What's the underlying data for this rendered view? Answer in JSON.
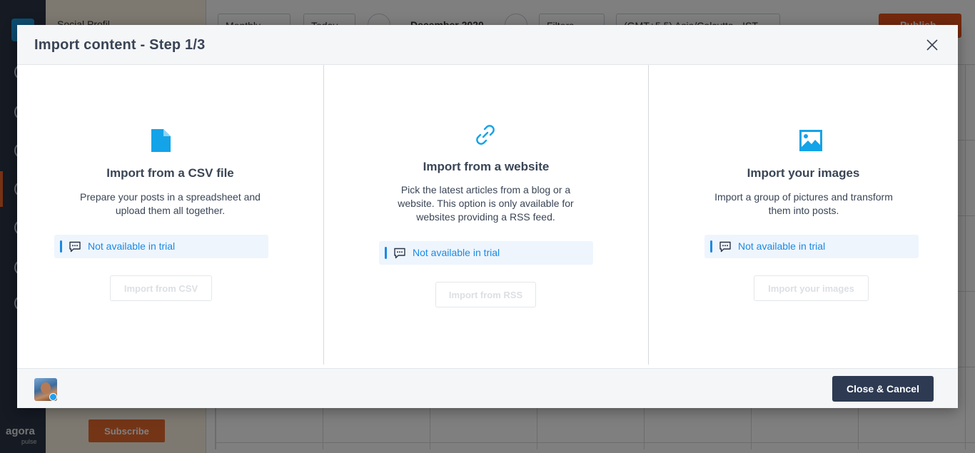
{
  "background": {
    "panel_title": "Social Profil...",
    "view_select": "Monthly",
    "today_button": "Today",
    "month_label": "December 2020",
    "filters_button": "Filters",
    "timezone_select": "(GMT+5.5) Asia/Calcutta - IST",
    "publish_button": "Publish",
    "subscribe_button": "Subscribe",
    "brand": "agora",
    "brand_sub": "pulse"
  },
  "modal": {
    "title": "Import content - Step 1/3",
    "options": [
      {
        "title": "Import from a CSV file",
        "description_lines": [
          "Prepare your posts in a spreadsheet and",
          "upload them all together."
        ],
        "trial_notice": "Not available in trial",
        "button": "Import from CSV",
        "icon": "file-icon"
      },
      {
        "title": "Import from a website",
        "description_lines": [
          "Pick the latest articles from a blog or a",
          "website. This option is only available for",
          "websites providing a RSS feed."
        ],
        "trial_notice": "Not available in trial",
        "button": "Import from RSS",
        "icon": "link-icon"
      },
      {
        "title": "Import your images",
        "description_lines": [
          "Import a group of pictures and transform",
          "them into posts."
        ],
        "trial_notice": "Not available in trial",
        "button": "Import your images",
        "icon": "image-icon"
      }
    ],
    "footer": {
      "cancel_button": "Close & Cancel"
    }
  },
  "colors": {
    "accent": "#1b8ae2",
    "icon_blue": "#13a3e8",
    "dark_button": "#2d3a52",
    "publish_orange": "#e8521c",
    "title_text": "#3a4556"
  }
}
